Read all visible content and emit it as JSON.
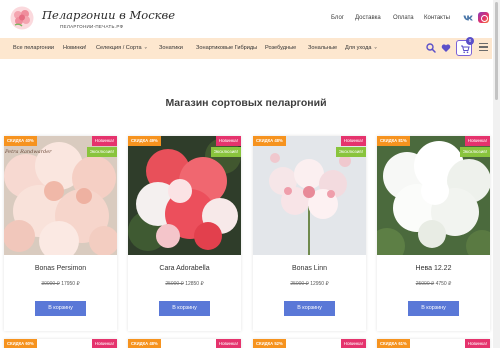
{
  "header": {
    "logo_title": "Пеларгонии в Москве",
    "logo_subtitle": "ПЕЛАРГОНИИ-ПЕЧАТЬ.РФ",
    "nav": [
      "Блог",
      "Доставка",
      "Оплата",
      "Контакты"
    ]
  },
  "menu": {
    "items": [
      "Все пеларгонии",
      "Новинки!",
      "Селекция / Сорта",
      "Зонатики",
      "Зонартиковые Гибриды",
      "Розебудные",
      "Зональные",
      "Для ухода"
    ],
    "cart_count": "0"
  },
  "main": {
    "title": "Магазин сортовых пеларгоний"
  },
  "products": [
    {
      "name": "Bonas Persimon",
      "old_price": "30000 ₽",
      "price": "17950 ₽",
      "sale": "СКИДКА 40%",
      "new": "Новинка!",
      "excl": "Эксклюзив!",
      "button": "В корзину",
      "watermark": "Petra Randwarder"
    },
    {
      "name": "Cara Adorabella",
      "old_price": "25000 ₽",
      "price": "12850 ₽",
      "sale": "СКИДКА 49%",
      "new": "Новинка!",
      "excl": "Эксклюзив!",
      "button": "В корзину"
    },
    {
      "name": "Bonas Linn",
      "old_price": "25000 ₽",
      "price": "12950 ₽",
      "sale": "СКИДКА 48%",
      "new": "Новинка!",
      "excl": "Эксклюзив!",
      "button": "В корзину"
    },
    {
      "name": "Нева 12.22",
      "old_price": "25000 ₽",
      "price": "4750 ₽",
      "sale": "СКИДКА 81%",
      "new": "Новинка!",
      "excl": "Эксклюзив!",
      "button": "В корзину"
    }
  ],
  "next_row": [
    {
      "sale": "СКИДКА 60%",
      "new": "Новинка!"
    },
    {
      "sale": "СКИДКА 48%",
      "new": "Новинка!"
    },
    {
      "sale": "СКИДКА 52%",
      "new": "Новинка!"
    },
    {
      "sale": "СКИДКА 61%",
      "new": "Новинка!"
    }
  ],
  "colors": {
    "menu_bg": "#fde7cf",
    "sale_badge": "#f6931f",
    "new_badge": "#e5336d",
    "excl_badge": "#89c43d",
    "button": "#5a78d7",
    "accent": "#5a4fc9"
  }
}
